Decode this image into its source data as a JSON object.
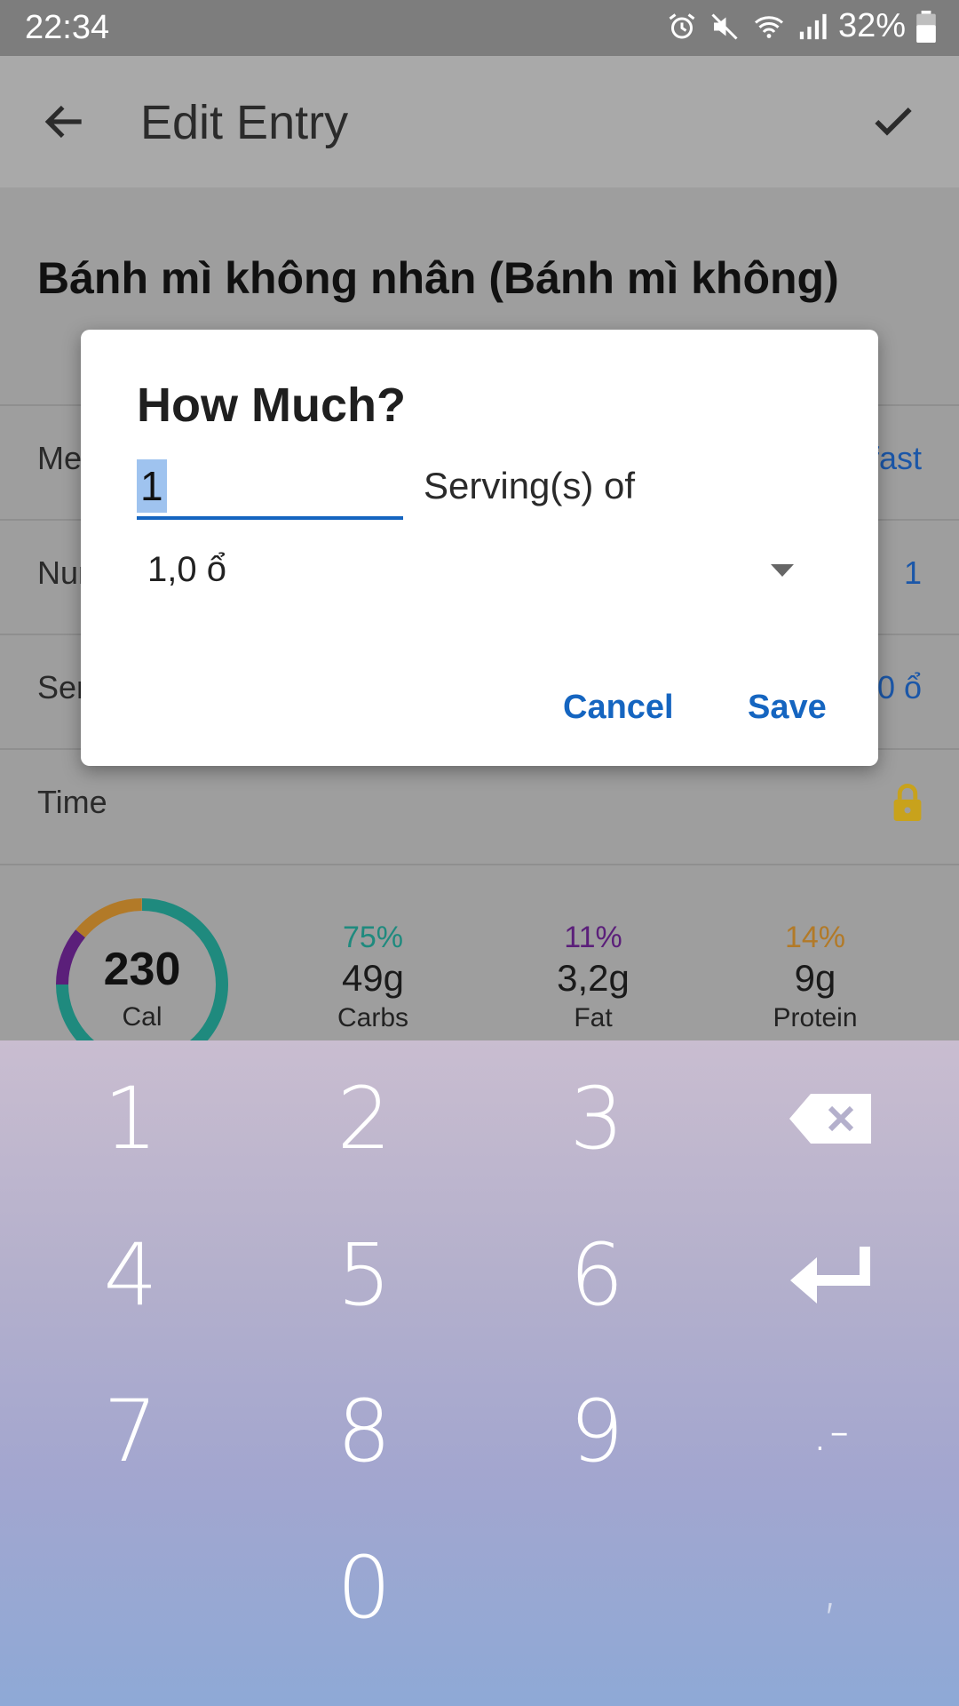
{
  "status_bar": {
    "time": "22:34",
    "battery": "32%"
  },
  "app_bar": {
    "title": "Edit Entry"
  },
  "food": {
    "name": "Bánh mì không nhân (Bánh mì không)"
  },
  "rows": [
    {
      "label": "Meal",
      "value": "Breakfast"
    },
    {
      "label": "Number of Servings",
      "value": "1"
    },
    {
      "label": "Serving Size",
      "value": "1,0 ổ"
    },
    {
      "label": "Time",
      "value": ""
    }
  ],
  "summary": {
    "calories": "230",
    "cal_label": "Cal",
    "carbs": {
      "pct": "75%",
      "amount": "49g",
      "label": "Carbs"
    },
    "fat": {
      "pct": "11%",
      "amount": "3,2g",
      "label": "Fat"
    },
    "protein": {
      "pct": "14%",
      "amount": "9g",
      "label": "Protein"
    }
  },
  "dialog": {
    "title": "How Much?",
    "quantity": "1",
    "servings_of": "Serving(s) of",
    "unit": "1,0 ổ",
    "cancel": "Cancel",
    "save": "Save"
  },
  "keypad": {
    "keys": [
      "1",
      "2",
      "3",
      "4",
      "5",
      "6",
      "7",
      "8",
      "9",
      ".-",
      "0",
      ","
    ]
  },
  "colors": {
    "accent": "#1565c0",
    "carbs": "#1f8a7e",
    "fat": "#5b1f7a",
    "protein": "#b27a28",
    "lock": "#c8a21c"
  }
}
